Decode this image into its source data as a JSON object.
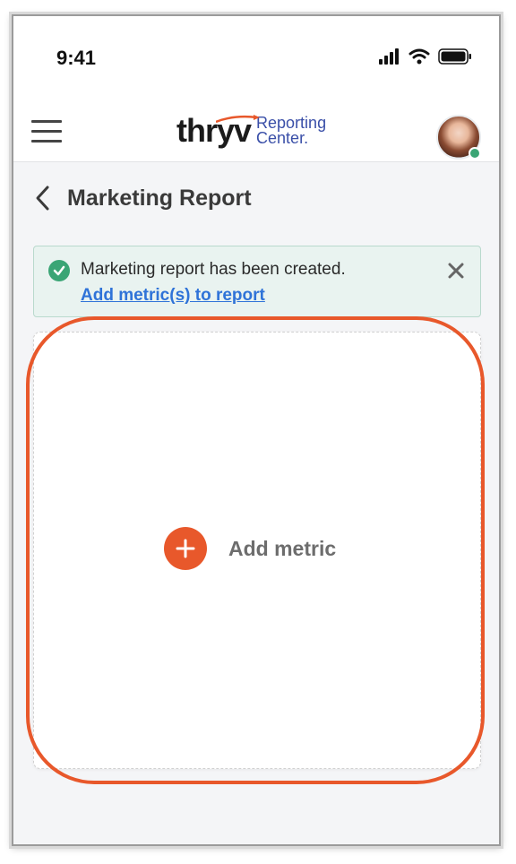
{
  "status_bar": {
    "time": "9:41"
  },
  "header": {
    "logo_wordmark": "thryv",
    "logo_subtitle_line1": "Reporting",
    "logo_subtitle_line2": "Center.",
    "avatar_status": "online"
  },
  "page": {
    "title": "Marketing Report"
  },
  "alert": {
    "message": "Marketing report has been created.",
    "link_text": "Add metric(s) to report"
  },
  "card": {
    "add_metric_label": "Add metric"
  },
  "colors": {
    "accent": "#e8582b",
    "success": "#3aa575",
    "link": "#2f73d8",
    "logo_subtitle": "#3a4fa8"
  },
  "icons": [
    "signal-icon",
    "wifi-icon",
    "battery-icon",
    "hamburger-menu-icon",
    "back-chevron-icon",
    "check-circle-icon",
    "close-icon",
    "plus-icon"
  ]
}
